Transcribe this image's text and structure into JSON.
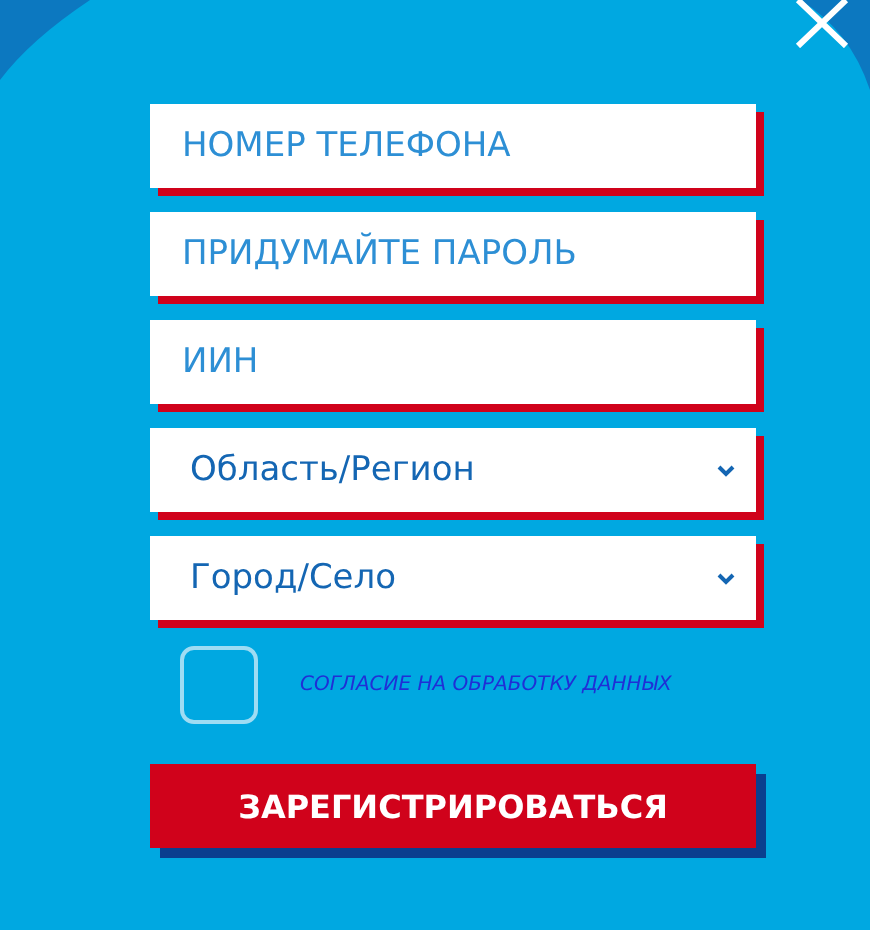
{
  "fields": [
    {
      "kind": "input",
      "placeholder": "НОМЕР ТЕЛЕФОНА"
    },
    {
      "kind": "input",
      "placeholder": "ПРИДУМАЙТЕ ПАРОЛЬ"
    },
    {
      "kind": "input",
      "placeholder": "ИИН"
    },
    {
      "kind": "select",
      "value": "Область/Регион"
    },
    {
      "kind": "select",
      "value": "Город/Село"
    }
  ],
  "consent": {
    "label": "СОГЛАСИЕ НА ОБРАБОТКУ ДАННЫХ",
    "checked": false
  },
  "submit_button": {
    "label": "ЗАРЕГИСТРИРОВАТЬСЯ"
  }
}
